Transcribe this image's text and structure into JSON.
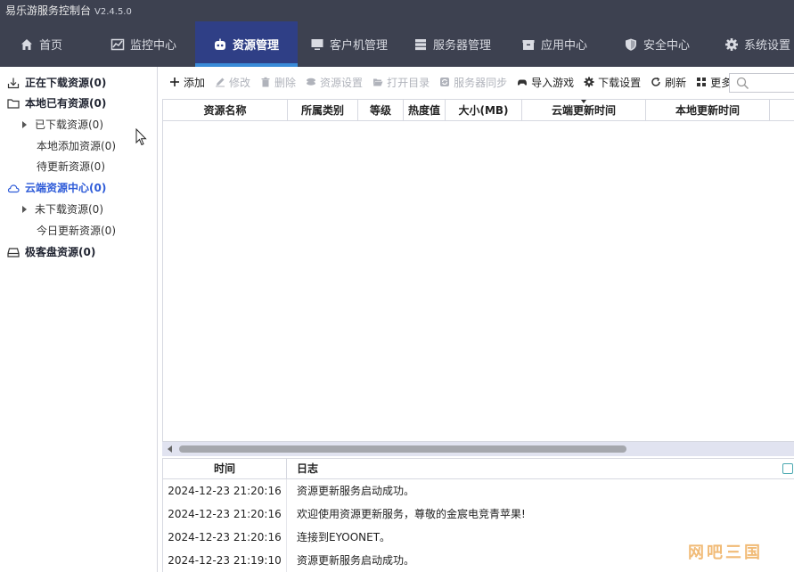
{
  "app": {
    "title": "易乐游服务控制台",
    "version": "V2.4.5.0"
  },
  "nav": [
    {
      "label": "首页",
      "icon": "home-icon"
    },
    {
      "label": "监控中心",
      "icon": "chart-icon"
    },
    {
      "label": "资源管理",
      "icon": "robot-icon",
      "active": true
    },
    {
      "label": "客户机管理",
      "icon": "monitor-icon"
    },
    {
      "label": "服务器管理",
      "icon": "server-icon"
    },
    {
      "label": "应用中心",
      "icon": "box-icon"
    },
    {
      "label": "安全中心",
      "icon": "shield-icon"
    },
    {
      "label": "系统设置",
      "icon": "gear-icon"
    }
  ],
  "sidebar": {
    "downloading": "正在下载资源(0)",
    "local_root": "本地已有资源(0)",
    "local_downloaded": "已下载资源(0)",
    "local_added": "本地添加资源(0)",
    "local_pending": "待更新资源(0)",
    "cloud_root": "云端资源中心(0)",
    "cloud_not_downloaded": "未下载资源(0)",
    "cloud_today": "今日更新资源(0)",
    "disk_root": "极客盘资源(0)"
  },
  "toolbar": {
    "add": "添加",
    "edit": "修改",
    "delete": "删除",
    "res_settings": "资源设置",
    "open_dir": "打开目录",
    "server_sync": "服务器同步",
    "import_game": "导入游戏",
    "download_settings": "下载设置",
    "refresh": "刷新",
    "more": "更多"
  },
  "grid": {
    "columns": [
      "资源名称",
      "所属类别",
      "等级",
      "热度值",
      "大小(MB)",
      "云端更新时间",
      "本地更新时间"
    ]
  },
  "log": {
    "col_time": "时间",
    "col_msg": "日志",
    "rows": [
      {
        "time": "2024-12-23 21:20:16",
        "msg": "资源更新服务启动成功。"
      },
      {
        "time": "2024-12-23 21:20:16",
        "msg": "欢迎使用资源更新服务，尊敬的金宸电竞青苹果!"
      },
      {
        "time": "2024-12-23 21:20:16",
        "msg": "连接到EYOONET。"
      },
      {
        "time": "2024-12-23 21:19:10",
        "msg": "资源更新服务启动成功。"
      }
    ]
  },
  "colors": {
    "nav_bg": "#3d4150",
    "nav_active": "#2f3f86",
    "accent": "#3a8bd8",
    "cloud_blue": "#2e5bd8"
  }
}
